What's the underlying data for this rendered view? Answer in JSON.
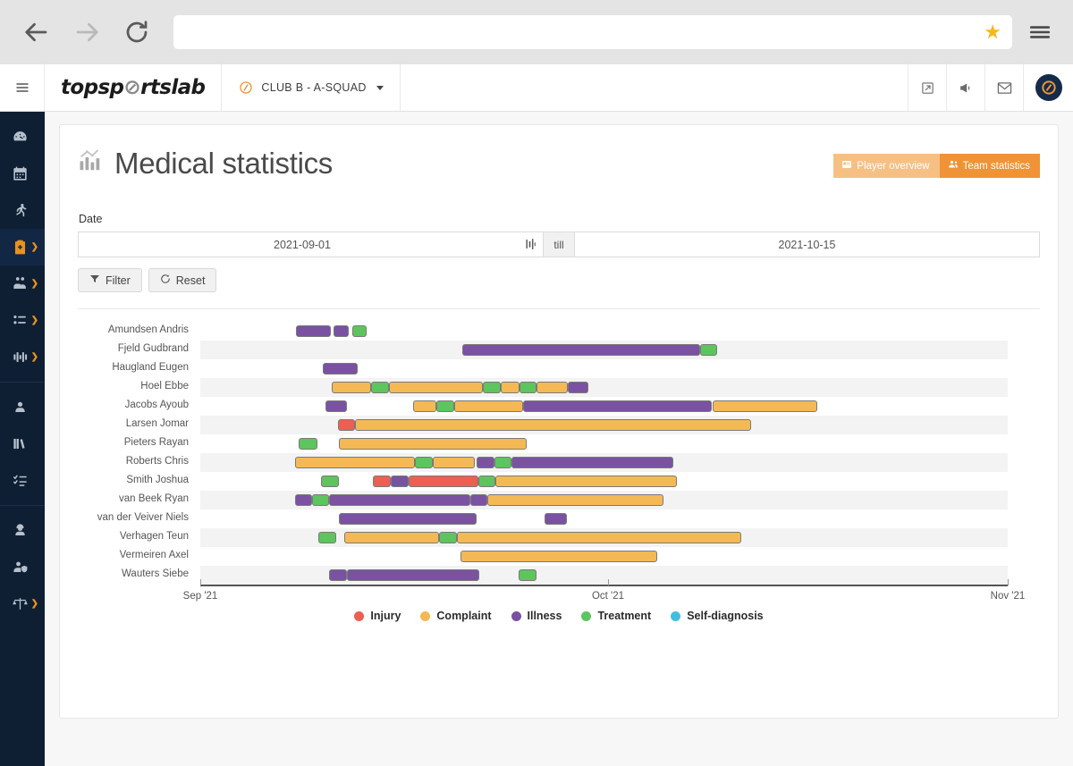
{
  "browser": {
    "back_icon": "arrow-left-icon",
    "forward_icon": "arrow-right-icon",
    "reload_icon": "reload-icon",
    "url_value": "",
    "url_placeholder": "",
    "bookmark_icon": "star-icon",
    "menu_icon": "hamburger-menu-icon"
  },
  "header": {
    "hamburger_icon": "hamburger-icon",
    "brand_pre": "topsp",
    "brand_mark": "⊘",
    "brand_post": "rtslab",
    "club_label": "CLUB B - A-SQUAD",
    "icons": [
      "external-link-icon",
      "megaphone-icon",
      "envelope-icon"
    ],
    "avatar": "user-avatar"
  },
  "sidebar": {
    "items": [
      {
        "name": "dashboard",
        "icon": "gauge-icon",
        "chevron": false,
        "active": false
      },
      {
        "name": "calendar",
        "icon": "calendar-icon",
        "chevron": false,
        "active": false
      },
      {
        "name": "training",
        "icon": "runner-icon",
        "chevron": true,
        "active": false
      },
      {
        "name": "medical",
        "icon": "medical-clipboard-icon",
        "chevron": true,
        "active": true
      },
      {
        "name": "team",
        "icon": "team-icon",
        "chevron": true,
        "active": false
      },
      {
        "name": "lineup",
        "icon": "lineup-list-icon",
        "chevron": true,
        "active": false
      },
      {
        "name": "performance",
        "icon": "equalizer-icon",
        "chevron": true,
        "active": false
      },
      {
        "name": "players",
        "icon": "player-profile-icon",
        "chevron": false,
        "active": false
      },
      {
        "name": "library",
        "icon": "books-icon",
        "chevron": false,
        "active": false
      },
      {
        "name": "tasks",
        "icon": "checklist-icon",
        "chevron": false,
        "active": false
      },
      {
        "name": "staff",
        "icon": "coach-icon",
        "chevron": false,
        "active": false
      },
      {
        "name": "privacy",
        "icon": "user-shield-icon",
        "chevron": false,
        "active": false
      },
      {
        "name": "compare",
        "icon": "scales-icon",
        "chevron": true,
        "active": false
      }
    ]
  },
  "page": {
    "title": "Medical statistics",
    "title_icon": "bar-chart-icon",
    "segments": [
      {
        "label": "Player overview",
        "icon": "id-card-icon",
        "active": false
      },
      {
        "label": "Team statistics",
        "icon": "people-icon",
        "active": true
      }
    ]
  },
  "filters": {
    "date_label": "Date",
    "date_from": "2021-09-01",
    "date_to": "2021-10-15",
    "till_label": "till",
    "date_picker_icon": "date-range-icon",
    "filter_button": "Filter",
    "filter_icon": "funnel-icon",
    "reset_button": "Reset",
    "reset_icon": "refresh-icon"
  },
  "chart_data": {
    "type": "bar",
    "subtype": "gantt-timeline",
    "title": "Medical statistics",
    "xlabel": "",
    "ylabel": "",
    "grid": false,
    "legend_position": "bottom",
    "x_axis": {
      "ticks": [
        "Sep '21",
        "Oct '21",
        "Nov '21"
      ],
      "tick_positions_pct": [
        0,
        50.5,
        100
      ],
      "range": [
        "2021-09-01",
        "2021-11-01"
      ]
    },
    "colors": {
      "Injury": "#ec5f52",
      "Complaint": "#f4b955",
      "Illness": "#7a52a1",
      "Treatment": "#5ec45e",
      "Self-diagnosis": "#42bfe0"
    },
    "legend": [
      {
        "label": "Injury",
        "color": "#ec5f52"
      },
      {
        "label": "Complaint",
        "color": "#f4b955"
      },
      {
        "label": "Illness",
        "color": "#7a52a1"
      },
      {
        "label": "Treatment",
        "color": "#5ec45e"
      },
      {
        "label": "Self-diagnosis",
        "color": "#42bfe0"
      }
    ],
    "categories": [
      "Amundsen Andris",
      "Fjeld Gudbrand",
      "Haugland Eugen",
      "Hoel Ebbe",
      "Jacobs Ayoub",
      "Larsen Jomar",
      "Pieters Rayan",
      "Roberts Chris",
      "Smith Joshua",
      "van Beek Ryan",
      "van der Veiver Niels",
      "Verhagen Teun",
      "Vermeiren Axel",
      "Wauters Siebe"
    ],
    "rows": [
      {
        "player": "Amundsen Andris",
        "striped": false,
        "segments": [
          {
            "type": "Illness",
            "start_pct": 11.9,
            "end_pct": 16.2
          },
          {
            "type": "Illness",
            "start_pct": 16.5,
            "end_pct": 18.4
          },
          {
            "type": "Treatment",
            "start_pct": 18.8,
            "end_pct": 20.6
          }
        ]
      },
      {
        "player": "Fjeld Gudbrand",
        "striped": true,
        "segments": [
          {
            "type": "Illness",
            "start_pct": 32.4,
            "end_pct": 61.9
          },
          {
            "type": "Treatment",
            "start_pct": 61.9,
            "end_pct": 64.0
          }
        ]
      },
      {
        "player": "Haugland Eugen",
        "striped": false,
        "segments": [
          {
            "type": "Illness",
            "start_pct": 15.2,
            "end_pct": 19.5
          }
        ]
      },
      {
        "player": "Hoel Ebbe",
        "striped": true,
        "segments": [
          {
            "type": "Complaint",
            "start_pct": 16.3,
            "end_pct": 21.2
          },
          {
            "type": "Treatment",
            "start_pct": 21.2,
            "end_pct": 23.4
          },
          {
            "type": "Complaint",
            "start_pct": 23.4,
            "end_pct": 35.0
          },
          {
            "type": "Treatment",
            "start_pct": 35.0,
            "end_pct": 37.2
          },
          {
            "type": "Complaint",
            "start_pct": 37.2,
            "end_pct": 39.5
          },
          {
            "type": "Treatment",
            "start_pct": 39.5,
            "end_pct": 41.6
          },
          {
            "type": "Complaint",
            "start_pct": 41.6,
            "end_pct": 45.5
          },
          {
            "type": "Illness",
            "start_pct": 45.5,
            "end_pct": 48.1
          }
        ]
      },
      {
        "player": "Jacobs Ayoub",
        "striped": false,
        "segments": [
          {
            "type": "Illness",
            "start_pct": 15.5,
            "end_pct": 18.2
          },
          {
            "type": "Complaint",
            "start_pct": 26.4,
            "end_pct": 29.2
          },
          {
            "type": "Treatment",
            "start_pct": 29.2,
            "end_pct": 31.4
          },
          {
            "type": "Complaint",
            "start_pct": 31.4,
            "end_pct": 40.0
          },
          {
            "type": "Illness",
            "start_pct": 40.0,
            "end_pct": 63.4
          },
          {
            "type": "Complaint",
            "start_pct": 63.4,
            "end_pct": 76.4
          }
        ]
      },
      {
        "player": "Larsen Jomar",
        "striped": true,
        "segments": [
          {
            "type": "Injury",
            "start_pct": 17.1,
            "end_pct": 19.2
          },
          {
            "type": "Complaint",
            "start_pct": 19.2,
            "end_pct": 68.2
          }
        ]
      },
      {
        "player": "Pieters Rayan",
        "striped": false,
        "segments": [
          {
            "type": "Treatment",
            "start_pct": 12.2,
            "end_pct": 14.5
          },
          {
            "type": "Complaint",
            "start_pct": 17.2,
            "end_pct": 40.4
          }
        ]
      },
      {
        "player": "Roberts Chris",
        "striped": true,
        "segments": [
          {
            "type": "Complaint",
            "start_pct": 11.7,
            "end_pct": 26.6
          },
          {
            "type": "Treatment",
            "start_pct": 26.6,
            "end_pct": 28.8
          },
          {
            "type": "Complaint",
            "start_pct": 28.8,
            "end_pct": 34.0
          },
          {
            "type": "Illness",
            "start_pct": 34.2,
            "end_pct": 36.4
          },
          {
            "type": "Treatment",
            "start_pct": 36.4,
            "end_pct": 38.5
          },
          {
            "type": "Illness",
            "start_pct": 38.5,
            "end_pct": 58.6
          }
        ]
      },
      {
        "player": "Smith Joshua",
        "striped": false,
        "segments": [
          {
            "type": "Treatment",
            "start_pct": 15.0,
            "end_pct": 17.2
          },
          {
            "type": "Injury",
            "start_pct": 21.4,
            "end_pct": 23.6
          },
          {
            "type": "Illness",
            "start_pct": 23.6,
            "end_pct": 25.8
          },
          {
            "type": "Injury",
            "start_pct": 25.8,
            "end_pct": 34.4
          },
          {
            "type": "Treatment",
            "start_pct": 34.4,
            "end_pct": 36.6
          },
          {
            "type": "Complaint",
            "start_pct": 36.6,
            "end_pct": 59.0
          }
        ]
      },
      {
        "player": "van Beek Ryan",
        "striped": true,
        "segments": [
          {
            "type": "Illness",
            "start_pct": 11.7,
            "end_pct": 13.8
          },
          {
            "type": "Treatment",
            "start_pct": 13.8,
            "end_pct": 16.0
          },
          {
            "type": "Illness",
            "start_pct": 16.0,
            "end_pct": 33.4
          },
          {
            "type": "Illness",
            "start_pct": 33.4,
            "end_pct": 35.6
          },
          {
            "type": "Complaint",
            "start_pct": 35.6,
            "end_pct": 57.4
          }
        ]
      },
      {
        "player": "van der Veiver Niels",
        "striped": false,
        "segments": [
          {
            "type": "Illness",
            "start_pct": 17.2,
            "end_pct": 34.2
          },
          {
            "type": "Illness",
            "start_pct": 42.6,
            "end_pct": 45.4
          }
        ]
      },
      {
        "player": "Verhagen Teun",
        "striped": true,
        "segments": [
          {
            "type": "Treatment",
            "start_pct": 14.6,
            "end_pct": 16.8
          },
          {
            "type": "Complaint",
            "start_pct": 17.8,
            "end_pct": 29.6
          },
          {
            "type": "Treatment",
            "start_pct": 29.6,
            "end_pct": 31.8
          },
          {
            "type": "Complaint",
            "start_pct": 31.8,
            "end_pct": 67.0
          }
        ]
      },
      {
        "player": "Vermeiren Axel",
        "striped": false,
        "segments": [
          {
            "type": "Complaint",
            "start_pct": 32.2,
            "end_pct": 56.6
          }
        ]
      },
      {
        "player": "Wauters Siebe",
        "striped": true,
        "segments": [
          {
            "type": "Illness",
            "start_pct": 16.0,
            "end_pct": 18.2
          },
          {
            "type": "Illness",
            "start_pct": 18.2,
            "end_pct": 34.6
          },
          {
            "type": "Treatment",
            "start_pct": 39.4,
            "end_pct": 41.6
          }
        ]
      }
    ]
  }
}
